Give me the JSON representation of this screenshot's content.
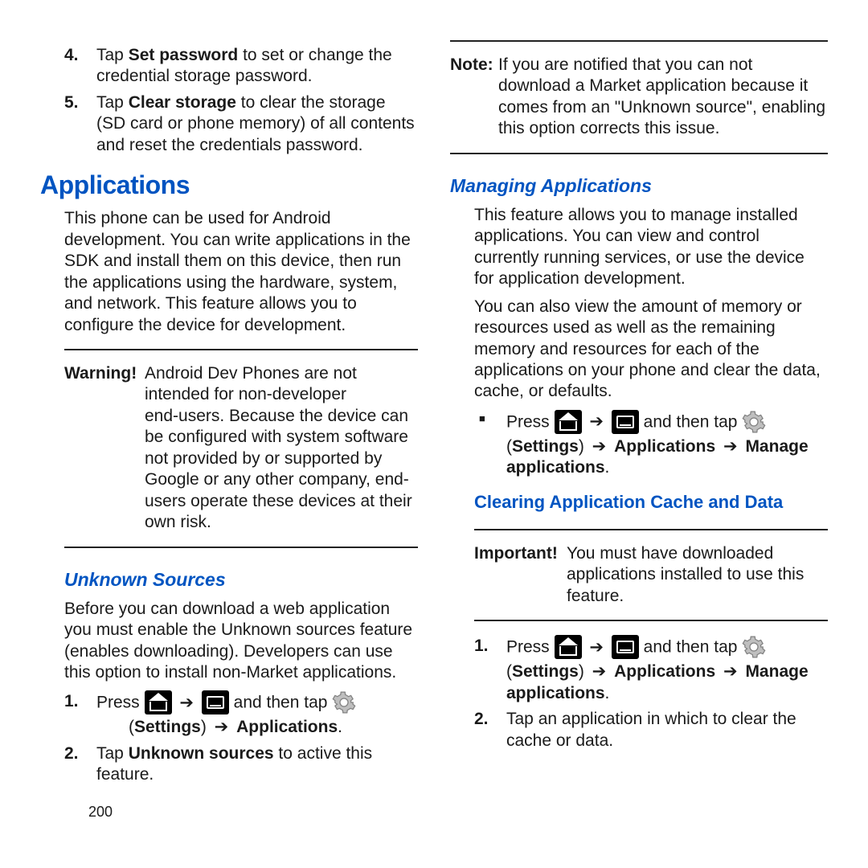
{
  "left": {
    "step4_pre": "Tap ",
    "step4_bold": "Set password",
    "step4_post": " to set or change the credential storage password.",
    "step5_pre": "Tap ",
    "step5_bold": "Clear storage",
    "step5_post": " to clear the storage (SD card or phone memory) of all contents and reset the credentials password.",
    "h1": "Applications",
    "p1": "This phone can be used for Android development. You can write applications in the SDK and install them on this device, then run the applications using the hardware, system, and network. This feature allows you to configure the device for development.",
    "warn_label": "Warning! ",
    "warn_1": "Android Dev Phones are not intended for non-developer",
    "warn_2": "end-users. Because the device can be configured with system software not provided by or supported by Google or any other company, end-users operate these devices at their own risk.",
    "h2": "Unknown Sources",
    "p2": "Before you can download a web application you must enable the Unknown sources feature (enables downloading). Developers can use this option to install non-Market applications.",
    "us1_press": "Press ",
    "us1_and": " and then tap ",
    "us1_line2_a": "(",
    "us1_line2_b": "Settings",
    "us1_line2_c": ") ",
    "us1_line2_d": "Applications",
    "us1_line2_e": ".",
    "us2_pre": "Tap ",
    "us2_bold": "Unknown sources",
    "us2_post": " to active this feature.",
    "pgnum": "200"
  },
  "right": {
    "note_label": "Note: ",
    "note": "If you are notified that you can not download a Market application because it comes from an \"Unknown source\", enabling this option corrects this issue.",
    "h2": "Managing Applications",
    "p1": "This feature allows you to manage installed applications. You can view and control currently running services, or use the device for application development.",
    "p2": "You can also view the amount of memory or resources used as well as the remaining memory and resources for each of the applications on your phone and clear the data, cache, or defaults.",
    "b1_press": "Press ",
    "b1_and": " and then tap ",
    "b1_line2_a": "(",
    "b1_line2_b": "Settings",
    "b1_line2_c": ") ",
    "b1_line2_d": "Applications",
    "b1_line2_e": " ",
    "b1_line2_f": "Manage applications",
    "b1_line2_g": ".",
    "h3": "Clearing Application Cache and Data",
    "imp_label": "Important! ",
    "imp": "You must have downloaded applications installed to use this feature.",
    "c1_press": "Press ",
    "c1_and": " and then tap ",
    "c1_line2_a": "(",
    "c1_line2_b": "Settings",
    "c1_line2_c": ") ",
    "c1_line2_d": "Applications",
    "c1_line2_e": " ",
    "c1_line2_f": "Manage applications",
    "c1_line2_g": ".",
    "c2": "Tap an application in which to clear the cache or data."
  },
  "arrow": "➔"
}
